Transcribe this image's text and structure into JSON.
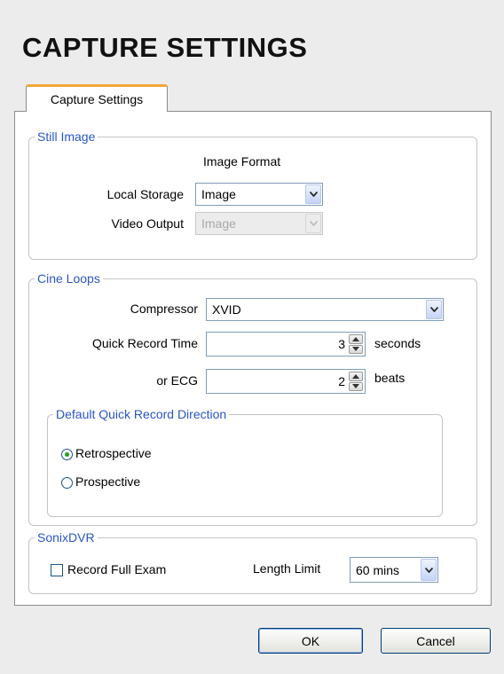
{
  "window": {
    "title": "CAPTURE SETTINGS"
  },
  "tabs": [
    {
      "label": "Capture Settings",
      "active": true
    }
  ],
  "still_image": {
    "legend": "Still Image",
    "column_header": "Image Format",
    "local_storage": {
      "label": "Local Storage",
      "value": "Image"
    },
    "video_output": {
      "label": "Video Output",
      "value": "Image",
      "disabled": true
    }
  },
  "cine_loops": {
    "legend": "Cine Loops",
    "compressor": {
      "label": "Compressor",
      "value": "XVID"
    },
    "quick_record_time": {
      "label": "Quick Record Time",
      "value": "3",
      "unit": "seconds"
    },
    "ecg": {
      "label": "or ECG",
      "value": "2",
      "unit": "beats"
    },
    "direction": {
      "legend": "Default Quick Record Direction",
      "options": [
        {
          "label": "Retrospective",
          "selected": true
        },
        {
          "label": "Prospective",
          "selected": false
        }
      ]
    }
  },
  "sonixdvr": {
    "legend": "SonixDVR",
    "record_full_exam": {
      "label": "Record Full Exam",
      "checked": false
    },
    "length_limit": {
      "label": "Length Limit",
      "value": "60 mins"
    }
  },
  "buttons": {
    "ok": "OK",
    "cancel": "Cancel"
  },
  "colors": {
    "accent_tab": "#f3a73b",
    "legend_blue": "#2b56c6",
    "radio_dot": "#21a121"
  }
}
